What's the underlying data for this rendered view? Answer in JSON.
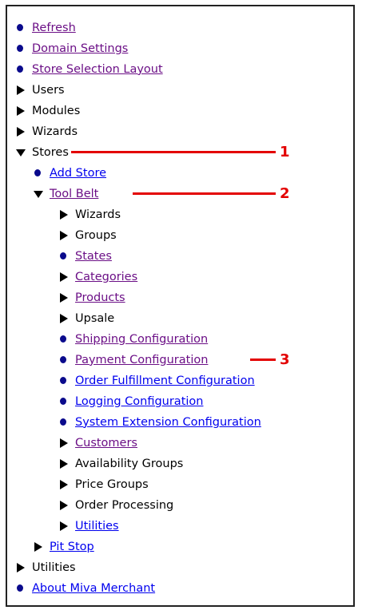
{
  "tree": {
    "items": [
      {
        "label": "Refresh",
        "icon": "bullet-icon",
        "link": "visited"
      },
      {
        "label": "Domain Settings",
        "icon": "bullet-icon",
        "link": "visited"
      },
      {
        "label": "Store Selection Layout",
        "icon": "bullet-icon",
        "link": "visited"
      },
      {
        "label": "Users",
        "icon": "expand-arrow-icon",
        "link": "none"
      },
      {
        "label": "Modules",
        "icon": "expand-arrow-icon",
        "link": "none"
      },
      {
        "label": "Wizards",
        "icon": "expand-arrow-icon",
        "link": "none"
      },
      {
        "label": "Stores",
        "icon": "collapse-arrow-icon",
        "link": "none"
      },
      {
        "label": "Add Store",
        "icon": "bullet-icon",
        "link": "unvisited"
      },
      {
        "label": "Tool Belt",
        "icon": "collapse-arrow-icon",
        "link": "visited"
      },
      {
        "label": "Wizards",
        "icon": "expand-arrow-icon",
        "link": "none"
      },
      {
        "label": "Groups",
        "icon": "expand-arrow-icon",
        "link": "none"
      },
      {
        "label": "States",
        "icon": "bullet-icon",
        "link": "visited"
      },
      {
        "label": "Categories",
        "icon": "expand-arrow-icon",
        "link": "visited"
      },
      {
        "label": "Products",
        "icon": "expand-arrow-icon",
        "link": "visited"
      },
      {
        "label": "Upsale",
        "icon": "expand-arrow-icon",
        "link": "none"
      },
      {
        "label": "Shipping Configuration",
        "icon": "bullet-icon",
        "link": "visited"
      },
      {
        "label": "Payment Configuration",
        "icon": "bullet-icon",
        "link": "visited"
      },
      {
        "label": "Order Fulfillment Configuration",
        "icon": "bullet-icon",
        "link": "unvisited"
      },
      {
        "label": "Logging Configuration",
        "icon": "bullet-icon",
        "link": "unvisited"
      },
      {
        "label": "System Extension Configuration",
        "icon": "bullet-icon",
        "link": "unvisited"
      },
      {
        "label": "Customers",
        "icon": "expand-arrow-icon",
        "link": "visited"
      },
      {
        "label": "Availability Groups",
        "icon": "expand-arrow-icon",
        "link": "none"
      },
      {
        "label": "Price Groups",
        "icon": "expand-arrow-icon",
        "link": "none"
      },
      {
        "label": "Order Processing",
        "icon": "expand-arrow-icon",
        "link": "none"
      },
      {
        "label": "Utilities",
        "icon": "expand-arrow-icon",
        "link": "unvisited"
      },
      {
        "label": "Pit Stop",
        "icon": "expand-arrow-icon",
        "link": "unvisited"
      },
      {
        "label": "Utilities",
        "icon": "expand-arrow-icon",
        "link": "none"
      },
      {
        "label": "About Miva Merchant",
        "icon": "bullet-icon",
        "link": "unvisited"
      }
    ]
  },
  "callouts": [
    {
      "number": "1",
      "target": "Stores"
    },
    {
      "number": "2",
      "target": "Tool Belt"
    },
    {
      "number": "3",
      "target": "Payment Configuration"
    }
  ],
  "colors": {
    "visited_link": "#6b0f86",
    "unvisited_link": "#0000ee",
    "bullet": "#0a0a8c",
    "callout": "#e30000"
  }
}
